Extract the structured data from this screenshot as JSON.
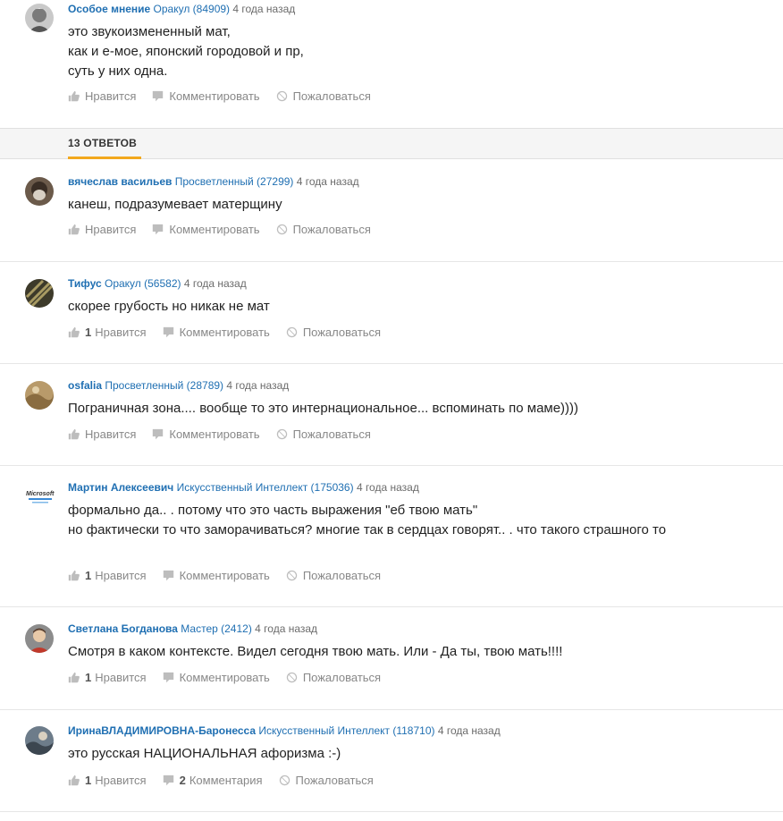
{
  "question": {
    "author": "Особое мнение",
    "rank": "Оракул (84909)",
    "time": "4 года назад",
    "text": "это звукоизмененный мат,\nкак и е-мое, японский городовой и пр,\nсуть у них одна.",
    "like_label": "Нравится",
    "comment_label": "Комментировать",
    "report_label": "Пожаловаться"
  },
  "answers_header": "13 ОТВЕТОВ",
  "answers": [
    {
      "author": "вячеслав васильев",
      "rank": "Просветленный (27299)",
      "time": "4 года назад",
      "text": "канеш, подразумевает матерщину",
      "likes": "",
      "like_label": "Нравится",
      "comments": "",
      "comment_label": "Комментировать",
      "report_label": "Пожаловаться"
    },
    {
      "author": "Тифус",
      "rank": "Оракул (56582)",
      "time": "4 года назад",
      "text": "скорее грубость но никак не мат",
      "likes": "1",
      "like_label": "Нравится",
      "comments": "",
      "comment_label": "Комментировать",
      "report_label": "Пожаловаться"
    },
    {
      "author": "osfalia",
      "rank": "Просветленный (28789)",
      "time": "4 года назад",
      "text": "Пограничная зона.... вообще то это интернациональное... вспоминать по маме))))",
      "likes": "",
      "like_label": "Нравится",
      "comments": "",
      "comment_label": "Комментировать",
      "report_label": "Пожаловаться"
    },
    {
      "author": "Мартин Алексеевич",
      "rank": "Искусственный Интеллект (175036)",
      "time": "4 года назад",
      "text": "формально да.. . потому что это часть выражения \"еб твою мать\"\nно фактически то что заморачиваться? многие так в сердцах говорят.. . что такого страшного то",
      "likes": "1",
      "like_label": "Нравится",
      "comments": "",
      "comment_label": "Комментировать",
      "report_label": "Пожаловаться",
      "avatar_text": "Microsoft"
    },
    {
      "author": "Светлана Богданова",
      "rank": "Мастер (2412)",
      "time": "4 года назад",
      "text": "Смотря в каком контексте. Видел сегодня твою мать. Или - Да ты, твою мать!!!!",
      "likes": "1",
      "like_label": "Нравится",
      "comments": "",
      "comment_label": "Комментировать",
      "report_label": "Пожаловаться"
    },
    {
      "author": "ИринаВЛАДИМИРОВНА-Баронесса",
      "rank": "Искусственный Интеллект (118710)",
      "time": "4 года назад",
      "text": "это русская НАЦИОНАЛЬНАЯ афоризма :-)",
      "likes": "1",
      "like_label": "Нравится",
      "comments": "2",
      "comment_label": "Комментария",
      "report_label": "Пожаловаться"
    }
  ],
  "colors": {
    "link": "#1f6fb2",
    "accent": "#f2a81d",
    "muted": "#888888"
  }
}
